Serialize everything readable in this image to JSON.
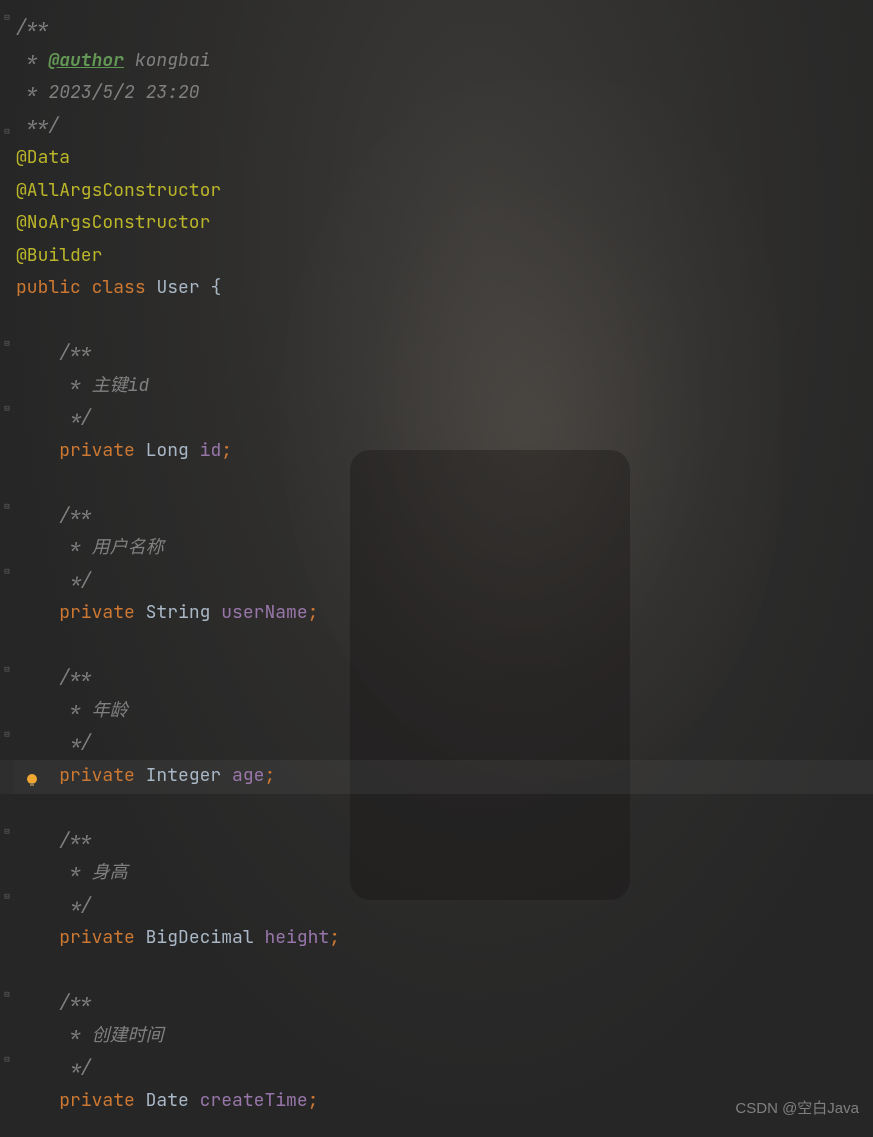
{
  "javadoc": {
    "open": "/**",
    "author_prefix": " * ",
    "author_tag": "@author",
    "author_name": " kongbai",
    "date_line": " * 2023/5/2 23:20",
    "close": " **/"
  },
  "annotations": [
    "@Data",
    "@AllArgsConstructor",
    "@NoArgsConstructor",
    "@Builder"
  ],
  "class_decl": {
    "public": "public",
    "class": "class",
    "name": "User",
    "brace": " {"
  },
  "fields": [
    {
      "doc_open": "/**",
      "doc_body": " * 主键id",
      "doc_close": " */",
      "modifier": "private",
      "type": "Long",
      "name": "id",
      "semi": ";"
    },
    {
      "doc_open": "/**",
      "doc_body": " * 用户名称",
      "doc_close": " */",
      "modifier": "private",
      "type": "String",
      "name": "userName",
      "semi": ";"
    },
    {
      "doc_open": "/**",
      "doc_body": " * 年龄",
      "doc_close": " */",
      "modifier": "private",
      "type": "Integer",
      "name": "age",
      "semi": ";"
    },
    {
      "doc_open": "/**",
      "doc_body": " * 身高",
      "doc_close": " */",
      "modifier": "private",
      "type": "BigDecimal",
      "name": "height",
      "semi": ";"
    },
    {
      "doc_open": "/**",
      "doc_body": " * 创建时间",
      "doc_close": " */",
      "modifier": "private",
      "type": "Date",
      "name": "createTime",
      "semi": ";"
    }
  ],
  "watermark": "CSDN @空白Java",
  "indent": "    "
}
